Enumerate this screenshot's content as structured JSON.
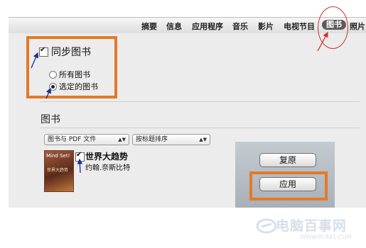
{
  "tabs": [
    {
      "label": "摘要",
      "active": false
    },
    {
      "label": "信息",
      "active": false
    },
    {
      "label": "应用程序",
      "active": false
    },
    {
      "label": "音乐",
      "active": false
    },
    {
      "label": "影片",
      "active": false
    },
    {
      "label": "电视节目",
      "active": false
    },
    {
      "label": "图书",
      "active": true
    },
    {
      "label": "照片",
      "active": false
    }
  ],
  "sync": {
    "label": "同步图书",
    "checked": true
  },
  "radio_options": [
    {
      "label": "所有图书",
      "selected": false
    },
    {
      "label": "选定的图书",
      "selected": true
    }
  ],
  "books_section": {
    "title": "图书",
    "filter_dropdown": "图书与 PDF 文件",
    "sort_dropdown": "按标题排序"
  },
  "book": {
    "title": "世界大趋势",
    "author": "约翰.奈斯比特",
    "checked": true,
    "cover_top": "Mind Set!",
    "cover_mid": "世界大趋势"
  },
  "buttons": {
    "revert": "复原",
    "apply": "应用"
  },
  "watermark": {
    "text": "电脑百事网",
    "url": "WWW.PC841.COM"
  },
  "colors": {
    "highlight": "#e27a27",
    "annotation": "#d13030",
    "arrow_blue": "#1d2f8f"
  }
}
